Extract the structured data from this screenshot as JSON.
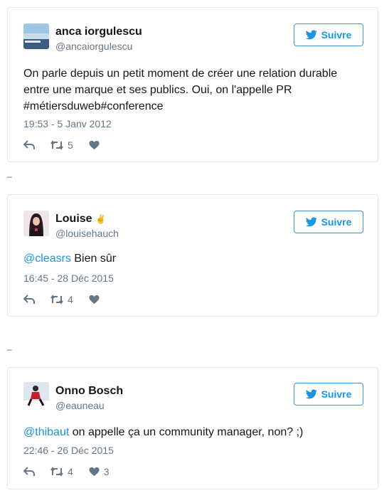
{
  "follow_label": "Suivre",
  "tweets": [
    {
      "name": "anca iorgulescu",
      "handle": "@ancaiorgulescu",
      "text": "On parle depuis un petit moment de créer une relation durable entre une marque et ses publics. Oui, on l'appelle PR #métiersduweb#conference",
      "time": "19:53 - 5 Janv 2012",
      "retweets": "5",
      "likes": ""
    },
    {
      "name": "Louise",
      "name_emoji": "✌",
      "handle": "@louisehauch",
      "mention": "@cleasrs",
      "text": " Bien sûr",
      "time": "16:45 - 28 Déc 2015",
      "retweets": "4",
      "likes": ""
    },
    {
      "name": "Onno Bosch",
      "handle": "@eauneau",
      "mention": "@thibaut",
      "text": " on appelle ça un community manager, non? ;)",
      "time": "22:46 - 26 Déc 2015",
      "retweets": "4",
      "likes": "3"
    }
  ],
  "separators": [
    "–",
    "–"
  ]
}
